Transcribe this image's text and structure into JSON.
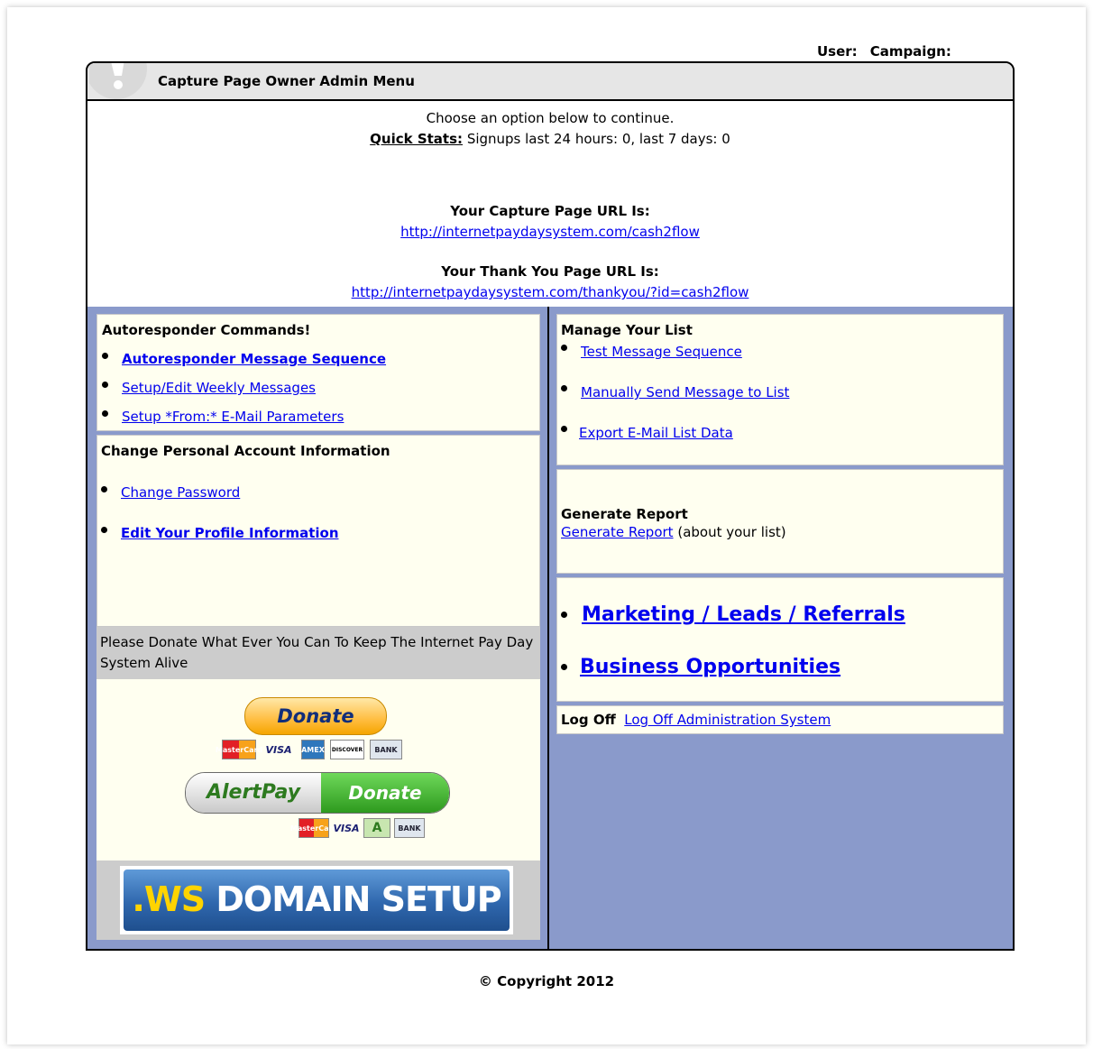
{
  "user_label": "User:",
  "campaign_label": "Campaign:",
  "header": {
    "title": "Capture Page Owner Admin Menu"
  },
  "intro": {
    "choose": "Choose an option below to continue.",
    "quick_stats_label": "Quick Stats:",
    "quick_stats_text": "Signups last 24 hours: 0, last 7 days: 0",
    "capture_label": "Your Capture Page URL Is:",
    "capture_url": "http://internetpaydaysystem.com/cash2flow",
    "thankyou_label": "Your Thank You Page URL Is:",
    "thankyou_url": "http://internetpaydaysystem.com/thankyou/?id=cash2flow"
  },
  "autoresponder": {
    "heading": "Autoresponder Commands!",
    "items": [
      "Autoresponder Message Sequence",
      "Setup/Edit Weekly Messages",
      "Setup *From:* E-Mail Parameters"
    ]
  },
  "account": {
    "heading": "Change Personal Account Information",
    "items": [
      "Change Password",
      "Edit Your Profile Information"
    ]
  },
  "donate": {
    "text": "Please Donate What Ever You Can To Keep The Internet Pay Day System Alive",
    "button_label": "Donate",
    "paypal_cards": [
      "MasterCard",
      "VISA",
      "AMEX",
      "DISCOVER",
      "BANK"
    ],
    "alertpay_brand": "AlertPay",
    "alertpay_label": "Donate",
    "alertpay_cards": [
      "MasterCard",
      "VISA",
      "A",
      "BANK"
    ]
  },
  "ws_banner": {
    "prefix": ".WS",
    "text": "DOMAIN SETUP"
  },
  "manage_list": {
    "heading": "Manage Your List",
    "items": [
      "Test Message Sequence",
      "Manually Send Message to List",
      "Export E-Mail List Data"
    ]
  },
  "report": {
    "heading": "Generate Report",
    "link": "Generate Report",
    "suffix": "(about your list)"
  },
  "big_links": [
    "Marketing / Leads / Referrals",
    "Business Opportunities"
  ],
  "logoff": {
    "label": "Log Off",
    "link": "Log Off Administration System"
  },
  "footer": {
    "copyright": "© Copyright 2012"
  },
  "colors": {
    "body_bg": "#8a9acb",
    "panel_bg": "#fffff0",
    "link": "#0000ee",
    "title_bar": "#e6e6e6"
  }
}
